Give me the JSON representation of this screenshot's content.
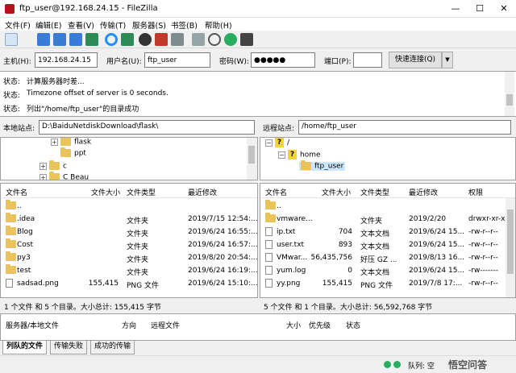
{
  "window": {
    "title": "ftp_user@192.168.24.15 - FileZilla",
    "minimize": "—",
    "maximize": "☐",
    "close": "✕"
  },
  "menu": [
    "文件(F)",
    "编辑(E)",
    "查看(V)",
    "传输(T)",
    "服务器(S)",
    "书签(B)",
    "帮助(H)"
  ],
  "quickconnect": {
    "host_label": "主机(H):",
    "host_value": "192.168.24.15",
    "user_label": "用户名(U):",
    "user_value": "ftp_user",
    "pass_label": "密码(W):",
    "pass_value": "●●●●●",
    "port_label": "端口(P):",
    "port_value": "",
    "connect_label": "快速连接(Q)",
    "dropdown": "▼"
  },
  "log": [
    {
      "label": "状态:",
      "text": "计算服务器时差..."
    },
    {
      "label": "状态:",
      "text": "Timezone offset of server is 0 seconds."
    },
    {
      "label": "状态:",
      "text": "列出\"/home/ftp_user\"的目录成功"
    }
  ],
  "local": {
    "site_label": "本地站点:",
    "site_path": "D:\\BaiduNetdiskDownload\\flask\\",
    "tree": [
      {
        "name": "flask",
        "expander": "+"
      },
      {
        "name": "ppt",
        "expander": ""
      },
      {
        "name": "c",
        "expander": "+"
      },
      {
        "name": "C Beau",
        "expander": "+"
      }
    ],
    "columns": [
      "文件名",
      "文件大小",
      "文件类型",
      "最近修改"
    ],
    "files": [
      {
        "name": "..",
        "size": "",
        "type": "",
        "modified": ""
      },
      {
        "name": ".idea",
        "size": "",
        "type": "文件夹",
        "modified": "2019/7/15 12:54:..."
      },
      {
        "name": "Blog",
        "size": "",
        "type": "文件夹",
        "modified": "2019/6/24 16:55:..."
      },
      {
        "name": "Cost",
        "size": "",
        "type": "文件夹",
        "modified": "2019/6/24 16:57:..."
      },
      {
        "name": "py3",
        "size": "",
        "type": "文件夹",
        "modified": "2019/8/20 20:54:..."
      },
      {
        "name": "test",
        "size": "",
        "type": "文件夹",
        "modified": "2019/6/24 16:19:..."
      },
      {
        "name": "sadsad.png",
        "size": "155,415",
        "type": "PNG 文件",
        "modified": "2019/6/24 15:10:..."
      }
    ],
    "status": "1 个文件 和 5 个目录。大小总计: 155,415 字节"
  },
  "remote": {
    "site_label": "远程站点:",
    "site_path": "/home/ftp_user",
    "tree": [
      {
        "name": "/",
        "expander": "−"
      },
      {
        "name": "home",
        "expander": "−"
      },
      {
        "name": "ftp_user",
        "expander": ""
      }
    ],
    "columns": [
      "文件名",
      "文件大小",
      "文件类型",
      "最近修改",
      "权限"
    ],
    "files": [
      {
        "name": "..",
        "size": "",
        "type": "",
        "modified": "",
        "perm": ""
      },
      {
        "name": "vmware...",
        "size": "",
        "type": "文件夹",
        "modified": "2019/2/20",
        "perm": "drwxr-xr-x"
      },
      {
        "name": "ip.txt",
        "size": "704",
        "type": "文本文档",
        "modified": "2019/6/24 15...",
        "perm": "-rw-r--r--"
      },
      {
        "name": "user.txt",
        "size": "893",
        "type": "文本文档",
        "modified": "2019/6/24 15...",
        "perm": "-rw-r--r--"
      },
      {
        "name": "VMwar...",
        "size": "56,435,756",
        "type": "好压 GZ ...",
        "modified": "2019/8/13 16...",
        "perm": "-rw-r--r--"
      },
      {
        "name": "yum.log",
        "size": "0",
        "type": "文本文档",
        "modified": "2019/6/24 15...",
        "perm": "-rw-------"
      },
      {
        "name": "yy.png",
        "size": "155,415",
        "type": "PNG 文件",
        "modified": "2019/7/8 17:...",
        "perm": "-rw-r--r--"
      }
    ],
    "status": "5 个文件 和 1 个目录。大小总计: 56,592,768 字节"
  },
  "queue": {
    "columns": [
      "服务器/本地文件",
      "方向",
      "远程文件",
      "大小",
      "优先级",
      "状态"
    ]
  },
  "tabs": [
    "列队的文件",
    "传输失败",
    "成功的传输"
  ],
  "statusbar": {
    "queue_label": "队列: 空",
    "watermark": "悟空问答"
  }
}
